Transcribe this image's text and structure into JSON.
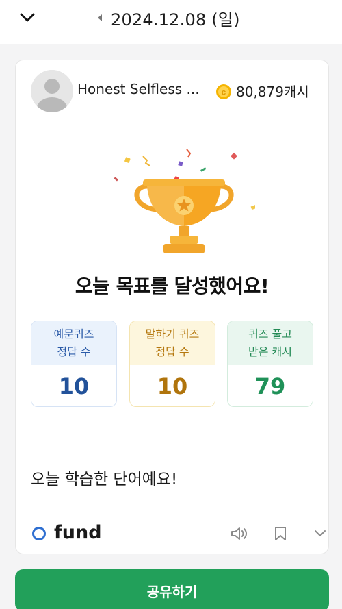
{
  "header": {
    "date": "2024.12.08 (일)",
    "collapse_icon": "chevron-down-icon",
    "prev_icon": "caret-left-icon"
  },
  "profile": {
    "username": "Honest Selfless ...",
    "cash": "80,879캐시",
    "coin_color": "#f5b400"
  },
  "achievement": {
    "message": "오늘 목표를 달성했어요!",
    "trophy_color": "#f6a623"
  },
  "stats": [
    {
      "line1": "예문퀴즈",
      "line2": "정답 수",
      "value": "10"
    },
    {
      "line1": "말하기 퀴즈",
      "line2": "정답 수",
      "value": "10"
    },
    {
      "line1": "퀴즈 풀고",
      "line2": "받은 캐시",
      "value": "79"
    }
  ],
  "words_section": {
    "title": "오늘 학습한 단어예요!",
    "words": [
      {
        "word": "fund"
      }
    ]
  },
  "share": {
    "label": "공유하기",
    "color": "#22a05a"
  }
}
